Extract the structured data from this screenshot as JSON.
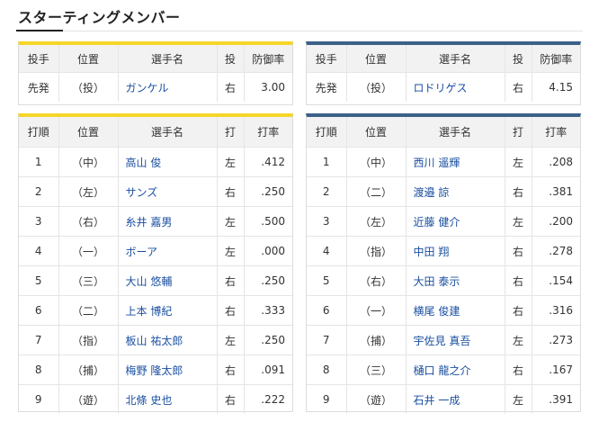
{
  "section_title": "スターティングメンバー",
  "pitcher_headers": [
    "投手",
    "位置",
    "選手名",
    "投",
    "防御率"
  ],
  "batting_headers": [
    "打順",
    "位置",
    "選手名",
    "打",
    "打率"
  ],
  "home": {
    "pitcher": {
      "role": "先発",
      "pos": "（投）",
      "name": "ガンケル",
      "hand": "右",
      "era": "3.00"
    },
    "batters": [
      {
        "order": "1",
        "pos": "（中）",
        "name": "高山 俊",
        "hand": "左",
        "avg": ".412"
      },
      {
        "order": "2",
        "pos": "（左）",
        "name": "サンズ",
        "hand": "右",
        "avg": ".250"
      },
      {
        "order": "3",
        "pos": "（右）",
        "name": "糸井 嘉男",
        "hand": "左",
        "avg": ".500"
      },
      {
        "order": "4",
        "pos": "（一）",
        "name": "ボーア",
        "hand": "左",
        "avg": ".000"
      },
      {
        "order": "5",
        "pos": "（三）",
        "name": "大山 悠輔",
        "hand": "右",
        "avg": ".250"
      },
      {
        "order": "6",
        "pos": "（二）",
        "name": "上本 博紀",
        "hand": "右",
        "avg": ".333"
      },
      {
        "order": "7",
        "pos": "（指）",
        "name": "板山 祐太郎",
        "hand": "左",
        "avg": ".250"
      },
      {
        "order": "8",
        "pos": "（捕）",
        "name": "梅野 隆太郎",
        "hand": "右",
        "avg": ".091"
      },
      {
        "order": "9",
        "pos": "（遊）",
        "name": "北條 史也",
        "hand": "右",
        "avg": ".222"
      }
    ]
  },
  "away": {
    "pitcher": {
      "role": "先発",
      "pos": "（投）",
      "name": "ロドリゲス",
      "hand": "右",
      "era": "4.15"
    },
    "batters": [
      {
        "order": "1",
        "pos": "（中）",
        "name": "西川 遥輝",
        "hand": "左",
        "avg": ".208"
      },
      {
        "order": "2",
        "pos": "（二）",
        "name": "渡邉 諒",
        "hand": "右",
        "avg": ".381"
      },
      {
        "order": "3",
        "pos": "（左）",
        "name": "近藤 健介",
        "hand": "左",
        "avg": ".200"
      },
      {
        "order": "4",
        "pos": "（指）",
        "name": "中田 翔",
        "hand": "右",
        "avg": ".278"
      },
      {
        "order": "5",
        "pos": "（右）",
        "name": "大田 泰示",
        "hand": "右",
        "avg": ".154"
      },
      {
        "order": "6",
        "pos": "（一）",
        "name": "横尾 俊建",
        "hand": "右",
        "avg": ".316"
      },
      {
        "order": "7",
        "pos": "（捕）",
        "name": "宇佐見 真吾",
        "hand": "左",
        "avg": ".273"
      },
      {
        "order": "8",
        "pos": "（三）",
        "name": "樋口 龍之介",
        "hand": "右",
        "avg": ".167"
      },
      {
        "order": "9",
        "pos": "（遊）",
        "name": "石井 一成",
        "hand": "左",
        "avg": ".391"
      }
    ]
  },
  "colors": {
    "home_accent": "#f5d62a",
    "away_accent": "#3c6187",
    "link": "#1a4fa0"
  }
}
